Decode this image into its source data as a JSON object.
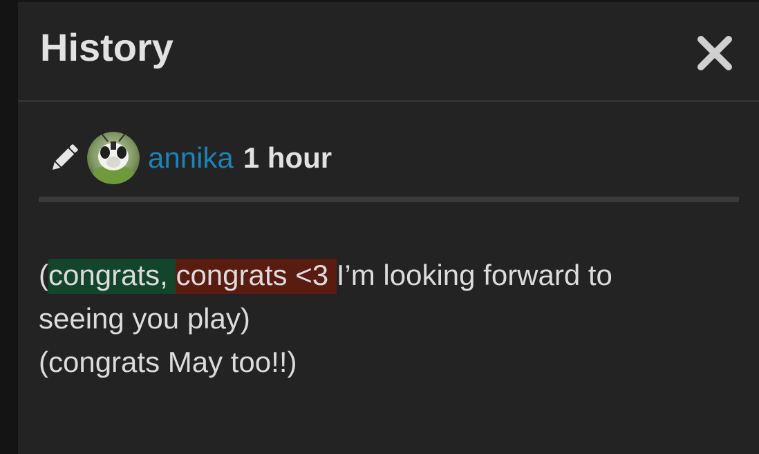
{
  "modal": {
    "title": "History",
    "close_icon": "close-icon"
  },
  "revision": {
    "edit_icon": "pencil-icon",
    "author": "annika",
    "time": "1 hour"
  },
  "diff": {
    "open_paren": "(",
    "added": "congrats, ",
    "removed": "congrats <3 ",
    "rest_line1": "I’m looking forward to",
    "line2": "seeing you play)",
    "line3": "(congrats May too!!)"
  },
  "colors": {
    "background": "#232323",
    "title_text": "#e2e2e2",
    "author_link": "#1b83b8",
    "diff_added_bg": "#13452c",
    "diff_removed_bg": "#5a1b10"
  }
}
